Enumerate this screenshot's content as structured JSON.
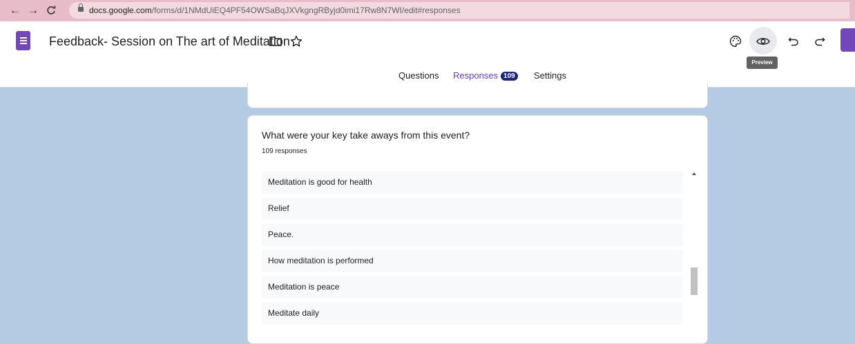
{
  "browser": {
    "url_host": "docs.google.com",
    "url_path": "/forms/d/1NMdUiEQ4PF54OWSaBqJXVkgngRByjd0imi17Rw8N7WI/edit#responses",
    "nav_icons": [
      "back-arrow-icon",
      "forward-arrow-icon",
      "reload-icon"
    ]
  },
  "header": {
    "doc_title": "Feedback- Session on The art of Meditation",
    "tooltip": "Preview",
    "icons": [
      "folder-icon",
      "star-icon",
      "palette-icon",
      "eye-icon",
      "undo-icon",
      "redo-icon"
    ]
  },
  "tabs": {
    "questions": "Questions",
    "responses": "Responses",
    "responses_count": "109",
    "settings": "Settings"
  },
  "question": {
    "title": "What were your key take aways from this event?",
    "count": "109 responses",
    "responses": [
      "Meditation is good for health",
      "Relief",
      "Peace.",
      "How meditation is performed",
      "Meditation is peace",
      "Meditate daily"
    ]
  },
  "colors": {
    "accent": "#673ab7",
    "badge": "#1a237e",
    "background": "#b4cbe3",
    "browser_bar": "#e9bcc9"
  }
}
